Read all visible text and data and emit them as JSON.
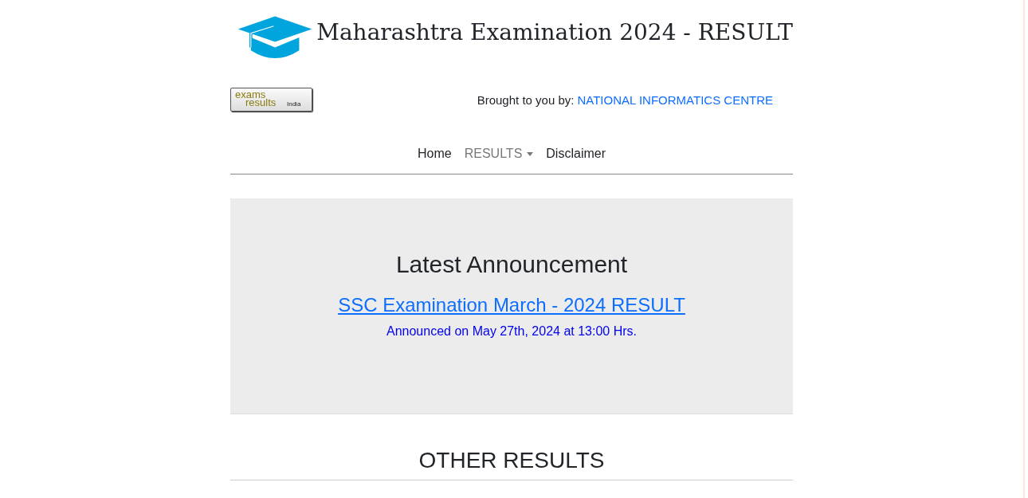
{
  "header": {
    "title": "Maharashtra Examination 2024 - RESULT"
  },
  "logo": {
    "line_1": "exams",
    "line_2": "results",
    "line_3": "India"
  },
  "credit": {
    "label": "Brought to you by:",
    "link": "NATIONAL INFORMATICS CENTRE"
  },
  "nav": [
    {
      "label": "Home",
      "kind": "link"
    },
    {
      "label": "RESULTS",
      "kind": "dropdown"
    },
    {
      "label": "Disclaimer",
      "kind": "link"
    }
  ],
  "announcement": {
    "heading": "Latest Announcement",
    "link": "SSC Examination March - 2024 RESULT",
    "note": "Announced on May 27th, 2024 at 13:00 Hrs."
  },
  "other_results": {
    "heading": "OTHER RESULTS"
  }
}
